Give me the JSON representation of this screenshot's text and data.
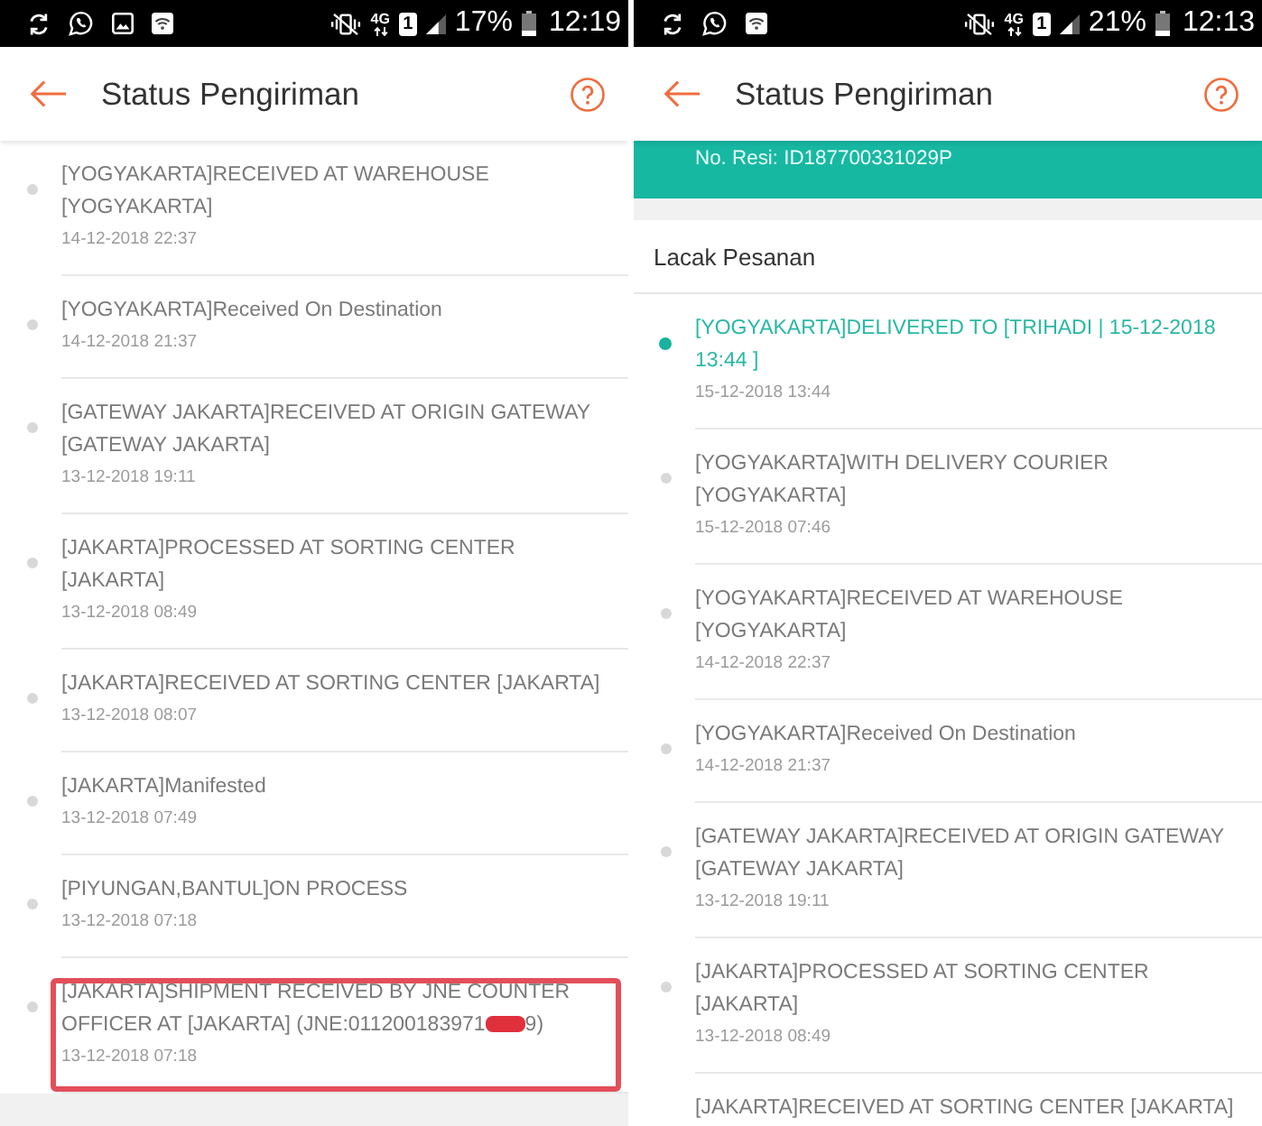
{
  "phones": [
    {
      "status_bar": {
        "notification_icons": [
          {
            "kind": "sync"
          },
          {
            "kind": "chat"
          },
          {
            "kind": "image"
          },
          {
            "kind": "wifi"
          }
        ],
        "network": "4G",
        "sim": "1",
        "battery": "17%",
        "time": "12:19"
      },
      "header": {
        "title": "Status Pengiriman"
      },
      "events": [
        {
          "title": "[YOGYAKARTA]RECEIVED AT WAREHOUSE [YOGYAKARTA]",
          "time": "14-12-2018 22:37",
          "active": false,
          "highlighted": false,
          "redacted": false
        },
        {
          "title": "[YOGYAKARTA]Received On Destination",
          "time": "14-12-2018 21:37",
          "active": false,
          "highlighted": false,
          "redacted": false
        },
        {
          "title": "[GATEWAY JAKARTA]RECEIVED AT ORIGIN GATEWAY [GATEWAY JAKARTA]",
          "time": "13-12-2018 19:11",
          "active": false,
          "highlighted": false,
          "redacted": false
        },
        {
          "title": "[JAKARTA]PROCESSED AT SORTING CENTER [JAKARTA]",
          "time": "13-12-2018 08:49",
          "active": false,
          "highlighted": false,
          "redacted": false
        },
        {
          "title": "[JAKARTA]RECEIVED AT SORTING CENTER [JAKARTA]",
          "time": "13-12-2018 08:07",
          "active": false,
          "highlighted": false,
          "redacted": false
        },
        {
          "title": "[JAKARTA]Manifested",
          "time": "13-12-2018 07:49",
          "active": false,
          "highlighted": false,
          "redacted": false
        },
        {
          "title": "[PIYUNGAN,BANTUL]ON PROCESS",
          "time": "13-12-2018 07:18",
          "active": false,
          "highlighted": false,
          "redacted": false
        },
        {
          "title": "[JAKARTA]SHIPMENT RECEIVED BY JNE COUNTER OFFICER AT [JAKARTA] (JNE:011200183971",
          "title_end": "9)",
          "time": "13-12-2018 07:18",
          "active": false,
          "highlighted": true,
          "redacted": true
        }
      ]
    },
    {
      "status_bar": {
        "notification_icons": [
          {
            "kind": "sync"
          },
          {
            "kind": "chat"
          },
          {
            "kind": "wifi"
          }
        ],
        "network": "4G",
        "sim": "1",
        "battery": "21%",
        "time": "12:13"
      },
      "header": {
        "title": "Status Pengiriman"
      },
      "tracking": {
        "receipt": "No. Resi: ID187700331029P"
      },
      "section_title": "Lacak Pesanan",
      "events": [
        {
          "title": "[YOGYAKARTA]DELIVERED TO [TRIHADI | 15-12-2018 13:44 ]",
          "time": "15-12-2018 13:44",
          "active": true,
          "highlighted": false,
          "redacted": false
        },
        {
          "title": "[YOGYAKARTA]WITH DELIVERY COURIER [YOGYAKARTA]",
          "time": "15-12-2018 07:46",
          "active": false,
          "highlighted": false,
          "redacted": false
        },
        {
          "title": "[YOGYAKARTA]RECEIVED AT WAREHOUSE [YOGYAKARTA]",
          "time": "14-12-2018 22:37",
          "active": false,
          "highlighted": false,
          "redacted": false
        },
        {
          "title": "[YOGYAKARTA]Received On Destination",
          "time": "14-12-2018 21:37",
          "active": false,
          "highlighted": false,
          "redacted": false
        },
        {
          "title": "[GATEWAY JAKARTA]RECEIVED AT ORIGIN GATEWAY [GATEWAY JAKARTA]",
          "time": "13-12-2018 19:11",
          "active": false,
          "highlighted": false,
          "redacted": false
        },
        {
          "title": "[JAKARTA]PROCESSED AT SORTING CENTER [JAKARTA]",
          "time": "13-12-2018 08:49",
          "active": false,
          "highlighted": false,
          "redacted": false
        },
        {
          "title": "[JAKARTA]RECEIVED AT SORTING CENTER [JAKARTA]",
          "active": false,
          "highlighted": false,
          "redacted": false
        }
      ]
    }
  ]
}
